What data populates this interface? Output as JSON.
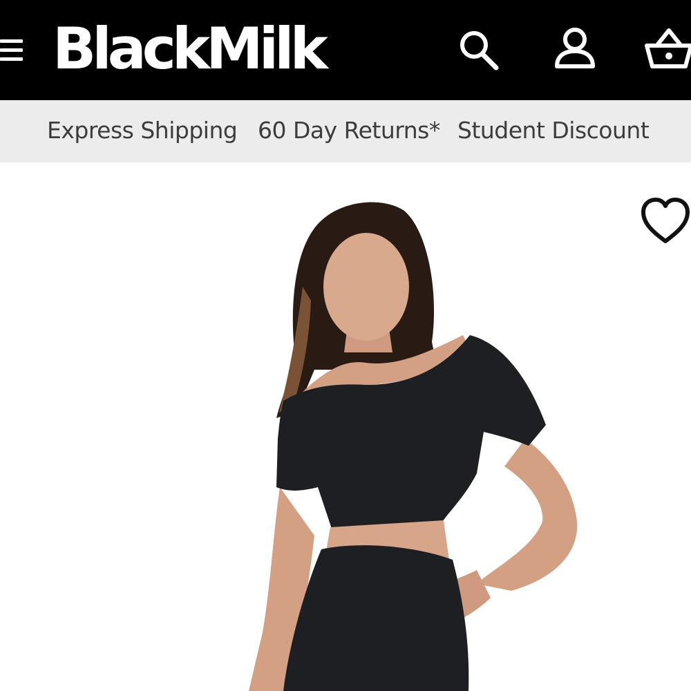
{
  "header": {
    "brand": "BlackMilk",
    "background": "#000000",
    "icons": [
      "menu-icon",
      "search-icon",
      "account-icon",
      "basket-icon"
    ]
  },
  "usp_bar": {
    "background": "#ececec",
    "items": [
      {
        "label": "Express Shipping"
      },
      {
        "label": "60 Day Returns*"
      },
      {
        "label": "Student Discount"
      }
    ]
  },
  "product": {
    "icons": [
      "heart-icon"
    ],
    "colors": {
      "garment": "#1e1f23",
      "skin": "#d7a58a",
      "hair": "#2a1a14"
    }
  }
}
